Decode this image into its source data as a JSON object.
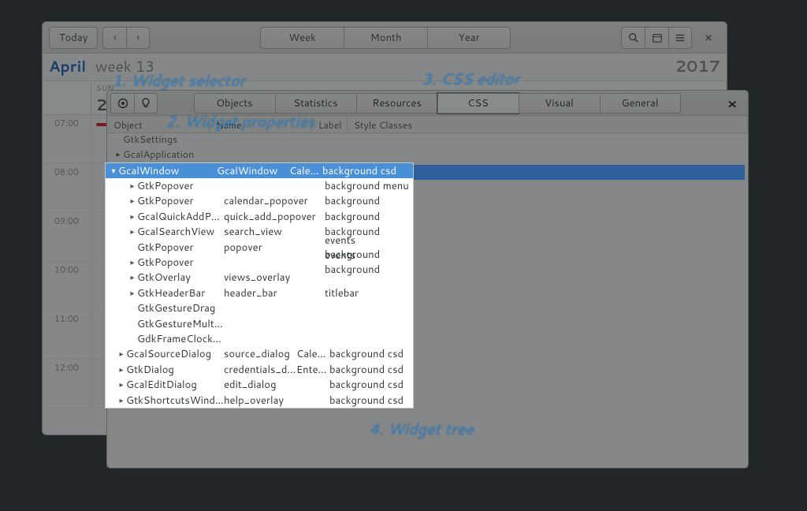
{
  "calendar": {
    "today_label": "Today",
    "month": "April",
    "week": "week 13",
    "year": "2017",
    "views": {
      "week": "Week",
      "month": "Month",
      "year": "Year"
    },
    "day": {
      "name": "SUN",
      "num": "2"
    },
    "times": [
      "07:00",
      "08:00",
      "09:00",
      "10:00",
      "11:00",
      "12:00"
    ]
  },
  "inspector": {
    "tabs": [
      "Objects",
      "Statistics",
      "Resources",
      "CSS",
      "Visual",
      "General"
    ],
    "active_tab": "CSS",
    "columns": {
      "object": "Object",
      "name": "Name",
      "label": "Label",
      "style": "Style Classes"
    },
    "roots": [
      {
        "object": "GtkSettings"
      },
      {
        "object": "GcalApplication",
        "caret": "▸"
      }
    ],
    "selected": {
      "object": "GcalWindow",
      "name": "GcalWindow",
      "label": "Calen...",
      "style": "background csd",
      "caret": "▾"
    },
    "children": [
      {
        "caret": "▸",
        "object": "GtkPopover",
        "name": "",
        "style": "background menu"
      },
      {
        "caret": "▸",
        "object": "GtkPopover",
        "name": "calendar_popover",
        "style": "background"
      },
      {
        "caret": "▸",
        "object": "GcalQuickAddPopover",
        "name": "quick_add_popover",
        "style": "background"
      },
      {
        "caret": "▸",
        "object": "GcalSearchView",
        "name": "search_view",
        "style": "background"
      },
      {
        "caret": "",
        "object": "GtkPopover",
        "name": "popover",
        "style": "events background"
      },
      {
        "caret": "▸",
        "object": "GtkPopover",
        "name": "",
        "style": "events background"
      },
      {
        "caret": "▸",
        "object": "GtkOverlay",
        "name": "views_overlay",
        "style": ""
      },
      {
        "caret": "▸",
        "object": "GtkHeaderBar",
        "name": "header_bar",
        "style": "titlebar"
      },
      {
        "caret": "",
        "object": "GtkGestureDrag",
        "name": "",
        "style": ""
      },
      {
        "caret": "",
        "object": "GtkGestureMultiPress",
        "name": "",
        "style": ""
      },
      {
        "caret": "",
        "object": "GdkFrameClockIdle",
        "name": "",
        "style": ""
      }
    ],
    "siblings": [
      {
        "caret": "▸",
        "object": "GcalSourceDialog",
        "name": "source_dialog",
        "label": "Calen...",
        "style": "background csd"
      },
      {
        "caret": "▸",
        "object": "GtkDialog",
        "name": "credentials_dialog",
        "label": "Enter ...",
        "style": "background csd"
      },
      {
        "caret": "▸",
        "object": "GcalEditDialog",
        "name": "edit_dialog",
        "label": "",
        "style": "background csd"
      },
      {
        "caret": "▸",
        "object": "GtkShortcutsWindow",
        "name": "help_overlay",
        "label": "",
        "style": "background csd"
      }
    ]
  },
  "annotations": {
    "a1": "1. Widget selector",
    "a2": "2. Widget properties",
    "a3": "3. CSS editor",
    "a4": "4. Widget tree"
  }
}
